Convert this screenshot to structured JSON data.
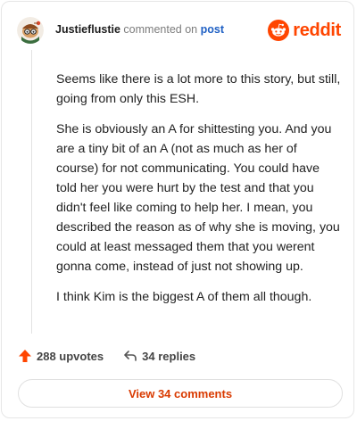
{
  "header": {
    "username": "Justieflustie",
    "commented_text": "commented on",
    "post_link": "post",
    "avatar_icon": "snoo-avatar-icon"
  },
  "brand": {
    "name": "reddit",
    "icon": "reddit-snoo-icon",
    "color": "#ff4500"
  },
  "comment": {
    "paragraphs": [
      "Seems like there is a lot more to this story, but still, going from only this ESH.",
      "She is obviously an A for shittesting you. And you are a tiny bit of an A (not as much as her of course) for not communicating. You could have told her you were hurt by the test and that you didn't feel like coming to help her. I mean, you described the reason as of why she is moving, you could at least messaged them that you werent gonna come, instead of just not showing up.",
      "I think Kim is the biggest A of them all though."
    ]
  },
  "actions": {
    "upvotes_label": "288 upvotes",
    "replies_label": "34 replies",
    "upvote_icon": "upvote-arrow-icon",
    "reply_icon": "reply-arrow-icon",
    "upvote_color": "#ff4500"
  },
  "footer": {
    "view_comments_label": "View 34 comments",
    "accent": "#d93a00"
  }
}
